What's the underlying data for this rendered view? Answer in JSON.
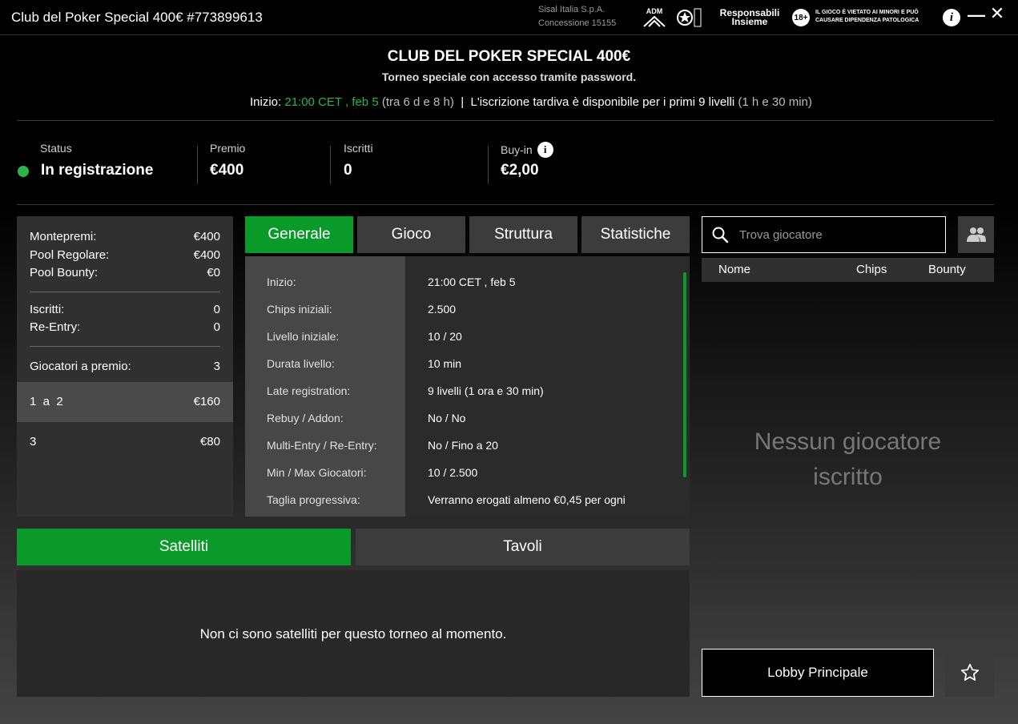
{
  "window": {
    "title": "Club del Poker Special 400€ #773899613",
    "operator_line1": "Sisal Italia S.p.A.",
    "operator_line2": "Concessione 15155",
    "adm_logo_text": "ADM",
    "resp_logo_line1": "Responsabili",
    "resp_logo_line2": "Insieme",
    "age_badge": "18+",
    "warning_text": "IL GIOCO È VIETATO AI MINORI E PUÒ CAUSARE DIPENDENZA PATOLOGICA",
    "info_glyph": "i",
    "minimize_glyph": "—",
    "close_glyph": "✕"
  },
  "header": {
    "tournament_name": "CLUB DEL POKER SPECIAL 400€",
    "subtitle": "Torneo speciale con accesso tramite password.",
    "start_label": "Inizio:",
    "start_value": "21:00 CET , feb 5",
    "start_eta": "(tra 6 d e 8 h)",
    "separator": "|",
    "late_reg_text": "L'iscrizione tardiva è disponibile per i primi 9 livelli",
    "late_reg_duration": "(1 h e 30 min)"
  },
  "stats": {
    "status_label": "Status",
    "status_value": "In registrazione",
    "prize_label": "Premio",
    "prize_value": "€400",
    "entrants_label": "Iscritti",
    "entrants_value": "0",
    "buyin_label": "Buy-in",
    "buyin_value": "€2,00",
    "buyin_info_glyph": "i"
  },
  "prize_panel": {
    "rows": [
      {
        "label": "Montepremi:",
        "value": "€400"
      },
      {
        "label": "Pool Regolare:",
        "value": "€400"
      },
      {
        "label": "Pool Bounty:",
        "value": "€0"
      },
      {
        "label": "Iscritti:",
        "value": "0"
      },
      {
        "label": "Re-Entry:",
        "value": "0"
      },
      {
        "label": "Giocatori a premio:",
        "value": "3"
      }
    ],
    "places": [
      {
        "rank": "1  a  2",
        "amount": "€160"
      },
      {
        "rank": "3",
        "amount": "€80"
      }
    ]
  },
  "tabs": [
    "Generale",
    "Gioco",
    "Struttura",
    "Statistiche"
  ],
  "info_table": [
    {
      "label": "Inizio:",
      "value": "21:00 CET , feb 5"
    },
    {
      "label": "Chips iniziali:",
      "value": "2.500"
    },
    {
      "label": "Livello iniziale:",
      "value": "10 / 20"
    },
    {
      "label": "Durata livello:",
      "value": "10 min"
    },
    {
      "label": "Late registration:",
      "value": "9 livelli (1 ora e 30 min)"
    },
    {
      "label": "Rebuy / Addon:",
      "value": "No / No"
    },
    {
      "label": "Multi-Entry / Re-Entry:",
      "value": "No / Fino a 20"
    },
    {
      "label": "Min / Max Giocatori:",
      "value": "10 / 2.500"
    },
    {
      "label": "Taglia progressiva:",
      "value": "Verranno erogati almeno €0,45 per ogni"
    }
  ],
  "bottom_tabs": [
    "Satelliti",
    "Tavoli"
  ],
  "satellites_message": "Non ci sono satelliti per questo torneo al momento.",
  "players": {
    "search_placeholder": "Trova giocatore",
    "columns": [
      "Nome",
      "Chips",
      "Bounty"
    ],
    "empty_line1": "Nessun giocatore",
    "empty_line2": "iscritto"
  },
  "footer": {
    "lobby_button": "Lobby Principale"
  },
  "colors": {
    "accent_green": "#0a9a2a",
    "status_green": "#2db34a"
  }
}
